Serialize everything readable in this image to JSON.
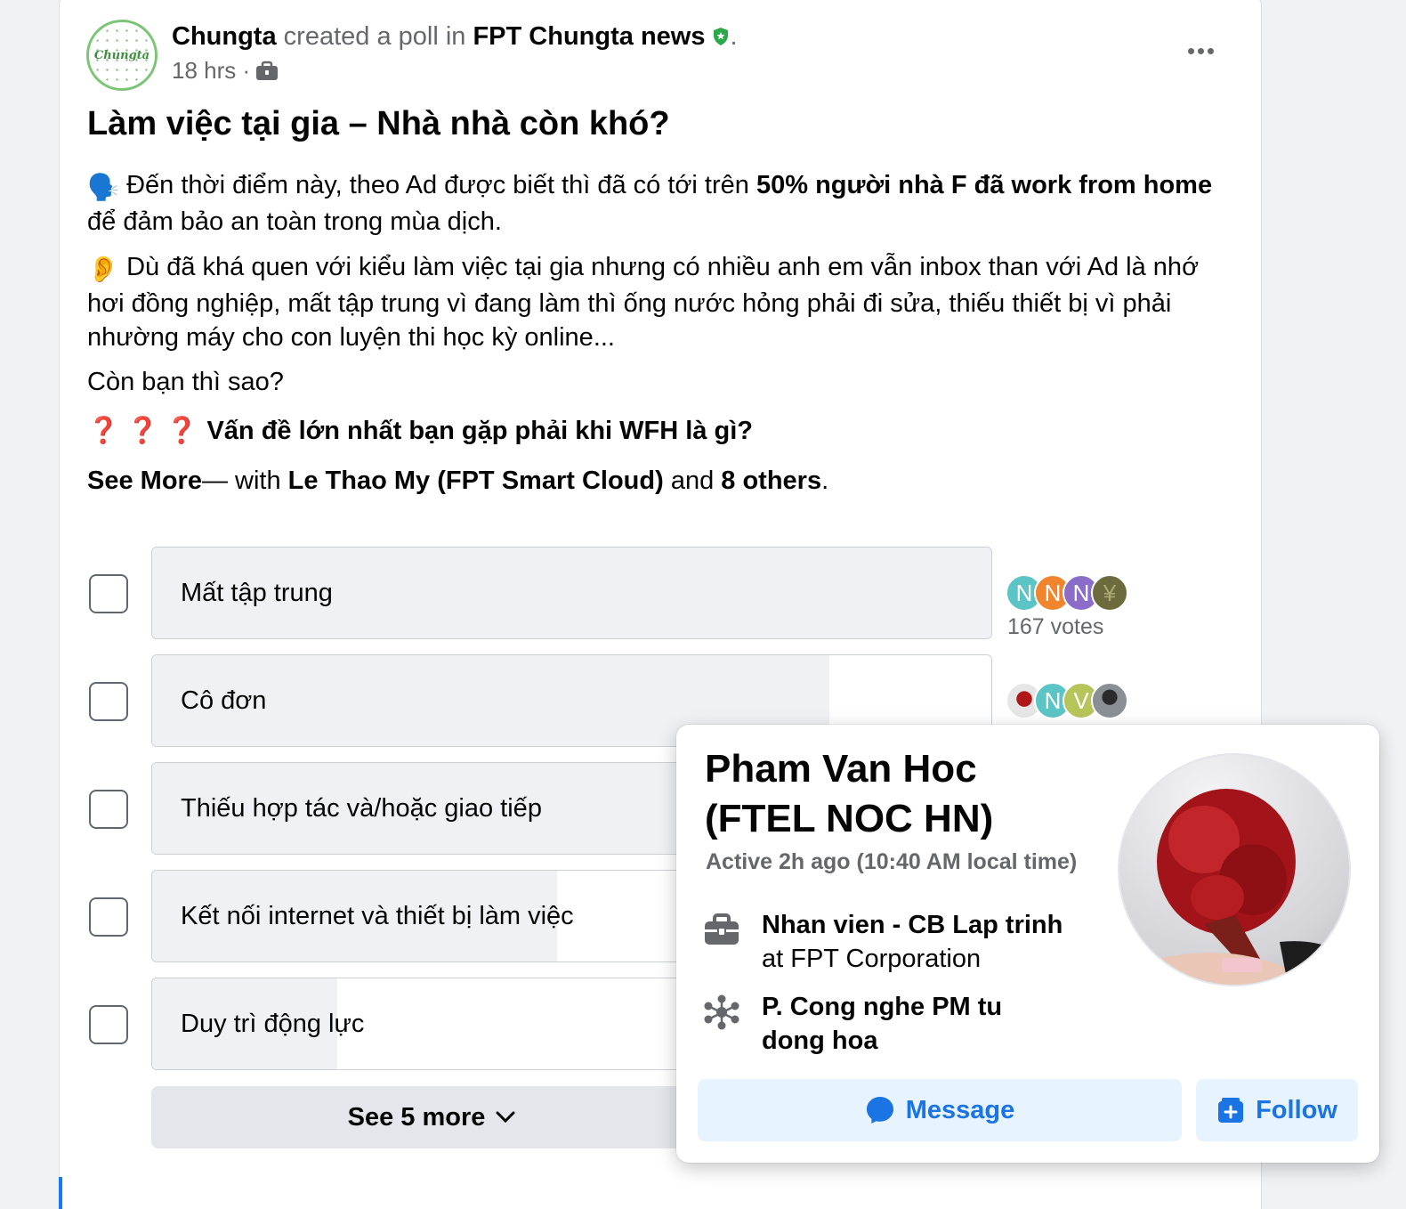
{
  "post": {
    "author": "Chungta",
    "action": "created a poll in",
    "group": "FPT Chungta news",
    "period": ".",
    "time": "18 hrs ·",
    "avatar_text": "Chungta",
    "title": "Làm việc tại gia – Nhà nhà còn khó?",
    "p1_icon": "🗣️",
    "p1_a": "Đến thời điểm này, theo Ad được biết thì đã có tới trên ",
    "p1_b": "50% người nhà F đã work from home",
    "p1_c": " để đảm bảo an toàn trong mùa dịch.",
    "p2_icon": "👂",
    "p2": "Dù đã khá quen với kiểu làm việc tại gia nhưng có nhiều anh em vẫn inbox than với Ad là nhớ hơi đồng nghiệp, mất tập trung vì đang làm thì ống nước hỏng phải đi sửa, thiếu thiết bị vì phải nhường máy cho con luyện thi học kỳ online...",
    "p3": "Còn bạn thì sao?",
    "q_icons": "❓ ❓ ❓",
    "question": "Vấn đề lớn nhất bạn gặp phải khi WFH là gì?",
    "see_more": "See More",
    "with_dash": "— with ",
    "tag_person": "Le Thao My (FPT Smart Cloud)",
    "and_text": " and ",
    "others": "8 others",
    "end": "."
  },
  "poll": {
    "options": [
      {
        "label": "Mất tập trung",
        "fill": 1.0
      },
      {
        "label": "Cô đơn",
        "fill": 0.807
      },
      {
        "label": "Thiếu hợp tác và/hoặc giao tiếp",
        "fill": 0.66
      },
      {
        "label": "Kết nối internet và thiết bị làm việc",
        "fill": 0.483
      },
      {
        "label": "Duy trì động lực",
        "fill": 0.221
      }
    ],
    "row1_voters": [
      "N",
      "N",
      "N",
      "¥"
    ],
    "row1_votes": "167 votes",
    "row2_voters": [
      "",
      "N",
      "V",
      ""
    ],
    "see_more_label": "See 5 more"
  },
  "hover_card": {
    "name": "Pham Van Hoc (FTEL NOC HN)",
    "active": "Active 2h ago (10:40 AM local time)",
    "job_title": "Nhan vien - CB Lap trinh",
    "job_company": "at FPT Corporation",
    "dept": "P. Cong nghe PM tu dong hoa",
    "message_label": "Message",
    "follow_label": "Follow"
  },
  "colors": {
    "accent": "#1b74e4",
    "muted": "#65676b",
    "green": "#7cc576",
    "voter_teal": "#5bc4c4",
    "voter_orange": "#f0852d",
    "voter_purple": "#8c6cc9",
    "voter_olive": "#6b6b3e",
    "voter_lime": "#b7c45a"
  }
}
